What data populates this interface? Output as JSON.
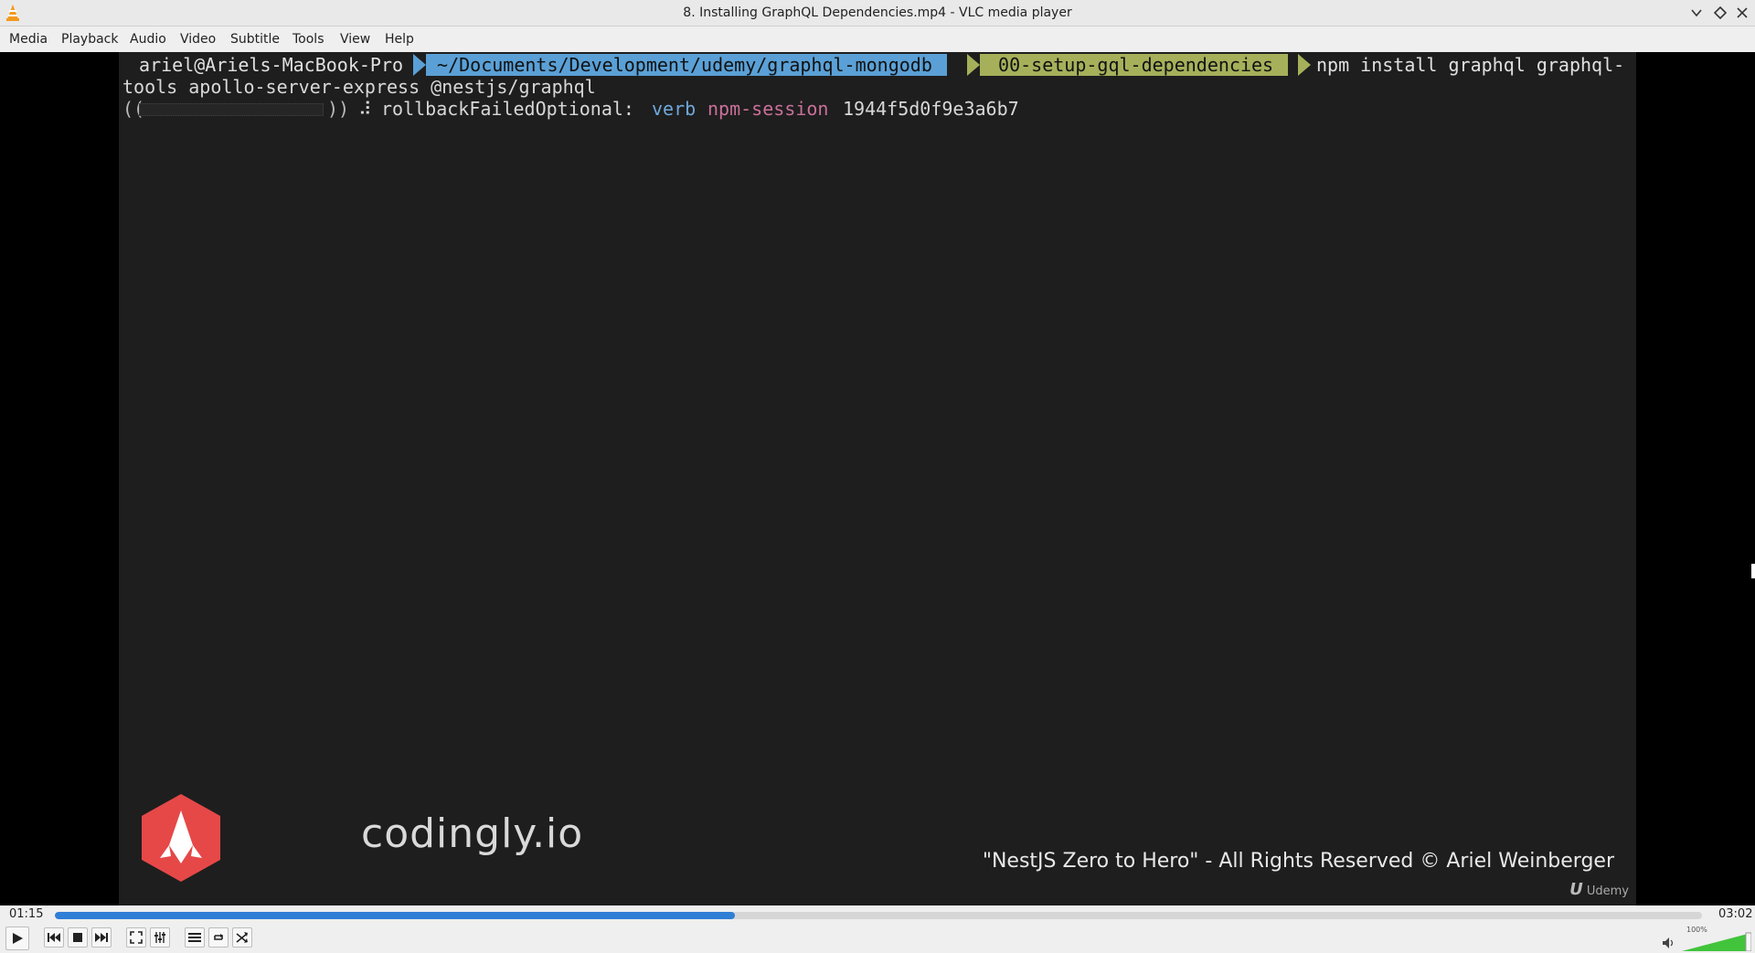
{
  "window": {
    "title": "8. Installing GraphQL Dependencies.mp4 - VLC media player"
  },
  "menu": [
    "Media",
    "Playback",
    "Audio",
    "Video",
    "Subtitle",
    "Tools",
    "View",
    "Help"
  ],
  "terminal": {
    "prompt_user": " ariel@Ariels-MacBook-Pro ",
    "prompt_path": " ~/Documents/Development/udemy/graphql-mongodb ",
    "prompt_branch": " 00-setup-gql-dependencies ",
    "command_part1": "npm install graphql graphql-",
    "command_part2": "tools apollo-server-express @nestjs/graphql",
    "progress_spinner": "⠼",
    "log_label": "rollbackFailedOptional:",
    "log_verb": "verb",
    "log_session": "npm-session",
    "log_id": "1944f5d0f9e3a6b7"
  },
  "overlay": {
    "logo_text": "codingly.io",
    "copyright": "\"NestJS Zero to Hero\" - All Rights Reserved © Ariel Weinberger",
    "udemy_mark": "Udemy"
  },
  "player": {
    "elapsed": "01:15",
    "total": "03:02",
    "progress_fraction": 0.413,
    "volume_label": "100%",
    "volume_fraction": 1.0
  },
  "colors": {
    "accent": "#2f7fd6",
    "prompt_path_bg": "#5aa0d6",
    "prompt_branch_bg": "#a6b05a",
    "log_verb": "#6fa8dc",
    "log_session": "#c9709a",
    "logo_red": "#e64848",
    "volume_green": "#41c43b"
  },
  "icons": {
    "app": "vlc-cone-icon",
    "play": "play-icon",
    "prev": "previous-icon",
    "stop": "stop-icon",
    "next": "next-icon",
    "fullscreen": "fullscreen-icon",
    "extended": "extended-settings-icon",
    "playlist": "playlist-icon",
    "loop": "loop-icon",
    "shuffle": "shuffle-icon",
    "volume": "speaker-icon"
  }
}
